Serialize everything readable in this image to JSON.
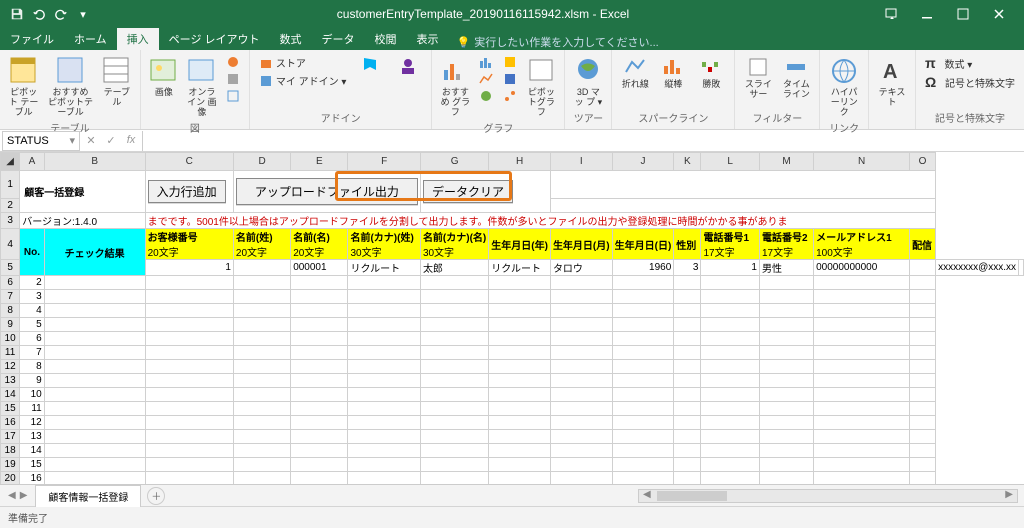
{
  "window": {
    "title": "customerEntryTemplate_20190116115942.xlsm - Excel"
  },
  "tabs": {
    "file": "ファイル",
    "home": "ホーム",
    "insert": "挿入",
    "pagelayout": "ページ レイアウト",
    "formulas": "数式",
    "data": "データ",
    "review": "校閲",
    "view": "表示",
    "tellme": "実行したい作業を入力してください..."
  },
  "ribbon": {
    "tables": {
      "pivot": "ピボット\nテーブル",
      "recpivot": "おすすめ\nピボットテーブル",
      "table": "テーブル",
      "group": "テーブル"
    },
    "illust": {
      "pic": "画像",
      "online": "オンライン\n画像",
      "shapes": "",
      "group": "図"
    },
    "addins": {
      "store": "ストア",
      "myaddins": "マイ アドイン ▾",
      "bing": "",
      "people": "",
      "group": "アドイン"
    },
    "charts": {
      "rec": "おすすめ\nグラフ",
      "pivotchart": "ピボットグラフ",
      "group": "グラフ"
    },
    "tours": {
      "map3d": "3D マッ\nプ ▾",
      "group": "ツアー"
    },
    "spark": {
      "line": "折れ線",
      "col": "縦棒",
      "winloss": "勝敗",
      "group": "スパークライン"
    },
    "filters": {
      "slicer": "スライサー",
      "timeline": "タイム\nライン",
      "group": "フィルター"
    },
    "links": {
      "hyperlink": "ハイパーリンク",
      "group": "リンク"
    },
    "text": {
      "text": "テキスト",
      "group": ""
    },
    "symbols": {
      "eq": "数式 ▾",
      "sym": "記号と特殊文字",
      "group": "記号と特殊文字"
    }
  },
  "namebox": "STATUS",
  "columns": [
    "",
    "A",
    "B",
    "C",
    "D",
    "E",
    "F",
    "G",
    "H",
    "I",
    "J",
    "K",
    "L",
    "M",
    "N",
    "O"
  ],
  "sheet": {
    "title": "顧客一括登録",
    "version": "バージョン:1.4.0",
    "btn_addrow": "入力行追加",
    "btn_upload": "アップロードファイル出力",
    "btn_clear": "データクリア",
    "note": "までです。5001件以上場合はアップロードファイルを分割して出力します。件数が多いとファイルの出力や登録処理に時間がかかる事がありま",
    "headers": {
      "no": "No.",
      "check": "チェック結果",
      "custno": "お客様番号",
      "custno2": "20文字",
      "sei": "名前(姓)",
      "sei2": "20文字",
      "mei": "名前(名)",
      "mei2": "20文字",
      "seik": "名前(カナ)(姓)",
      "seik2": "30文字",
      "meik": "名前(カナ)(名)",
      "meik2": "30文字",
      "by": "生年月日(年)",
      "bm": "生年月日(月)",
      "bd": "生年月日(日)",
      "sex": "性別",
      "tel1": "電話番号1",
      "tel1b": "17文字",
      "tel2": "電話番号2",
      "tel2b": "17文字",
      "mail": "メールアドレス1",
      "mail2": "100文字",
      "dist": "配信"
    },
    "row1": {
      "no": "1",
      "custno": "000001",
      "sei": "リクルート",
      "mei": "太郎",
      "seik": "リクルート",
      "meik": "タロウ",
      "by": "1960",
      "bm": "3",
      "bd": "1",
      "sex": "男性",
      "tel1": "00000000000",
      "mail": "xxxxxxxx@xxx.xx"
    }
  },
  "sheettab": "顧客情報一括登録",
  "status": "準備完了"
}
